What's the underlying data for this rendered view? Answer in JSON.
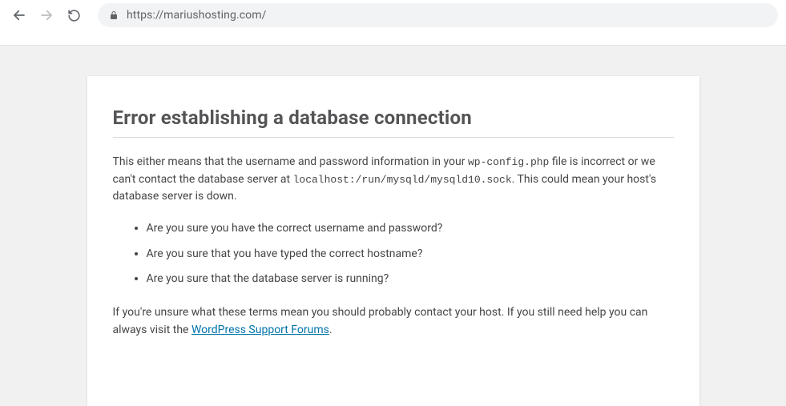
{
  "browser": {
    "url": "https://mariushosting.com/"
  },
  "error": {
    "title": "Error establishing a database connection",
    "intro_pre": "This either means that the username and password information in your ",
    "config_file": "wp-config.php",
    "intro_mid": " file is incorrect or we can't contact the database server at ",
    "db_host": "localhost:/run/mysqld/mysqld10.sock",
    "intro_post": ". This could mean your host's database server is down.",
    "checks": [
      "Are you sure you have the correct username and password?",
      "Are you sure that you have typed the correct hostname?",
      "Are you sure that the database server is running?"
    ],
    "outro_pre": "If you're unsure what these terms mean you should probably contact your host. If you still need help you can always visit the ",
    "forums_label": "WordPress Support Forums",
    "outro_post": "."
  }
}
